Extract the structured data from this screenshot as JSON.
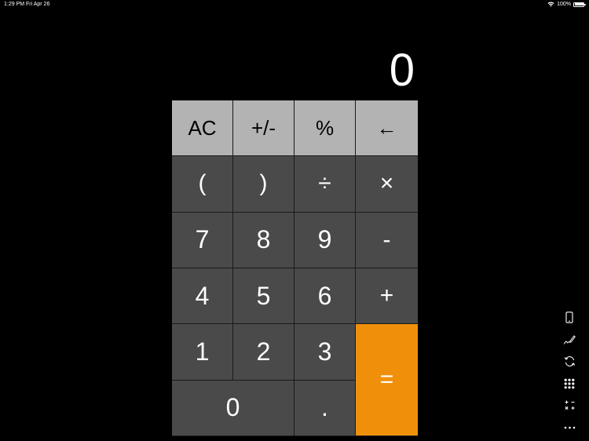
{
  "status": {
    "time": "1:29 PM",
    "date": "Fri Apr 26",
    "battery": "100%"
  },
  "display": {
    "value": "0"
  },
  "keys": {
    "ac": "AC",
    "sign": "+/-",
    "percent": "%",
    "backspace": "←",
    "open_paren": "(",
    "close_paren": ")",
    "divide": "÷",
    "multiply": "×",
    "seven": "7",
    "eight": "8",
    "nine": "9",
    "minus": "-",
    "four": "4",
    "five": "5",
    "six": "6",
    "plus": "+",
    "one": "1",
    "two": "2",
    "three": "3",
    "equals": "=",
    "zero": "0",
    "decimal": "."
  },
  "colors": {
    "function_key": "#b3b3b3",
    "digit_key": "#4a4a4a",
    "equals_key": "#f0900a"
  },
  "sidebar_icons": [
    "phone-layout-icon",
    "pencil-icon",
    "rotate-icon",
    "grid-keypad-icon",
    "operators-icon",
    "more-icon"
  ]
}
